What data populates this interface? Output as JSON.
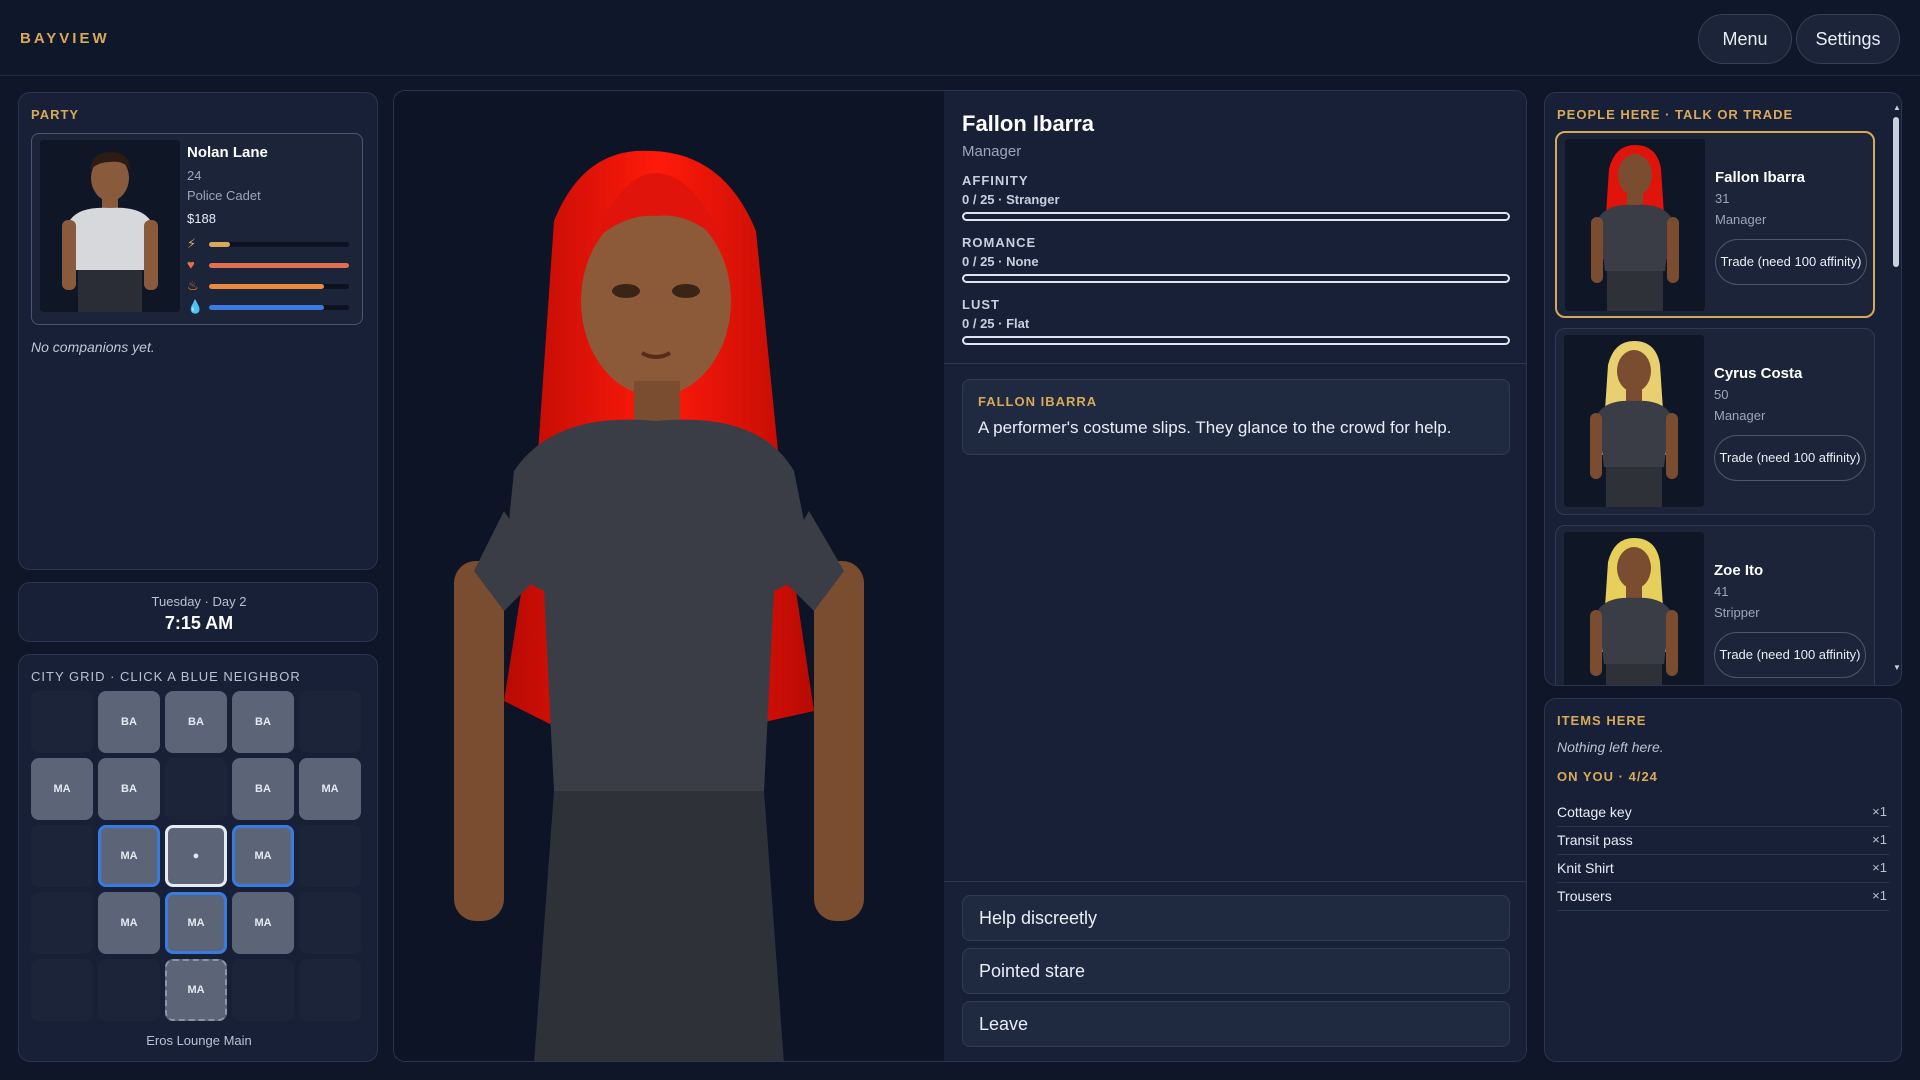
{
  "app": {
    "brand": "BAYVIEW"
  },
  "topbar": {
    "menu_label": "Menu",
    "settings_label": "Settings"
  },
  "party": {
    "label": "PARTY",
    "member": {
      "name": "Nolan Lane",
      "age": "24",
      "role": "Police Cadet",
      "cash": "$188",
      "stats": [
        {
          "icon": "energy-icon",
          "glyph": "⚡",
          "color": "#d9a95a",
          "value": 0.15
        },
        {
          "icon": "heart-icon",
          "glyph": "♥",
          "color": "#e07050",
          "value": 1.0
        },
        {
          "icon": "food-icon",
          "glyph": "♨",
          "color": "#e88a40",
          "value": 0.82
        },
        {
          "icon": "water-icon",
          "glyph": "💧",
          "color": "#3a7be0",
          "value": 0.82
        }
      ]
    },
    "companions_text": "No companions yet."
  },
  "clock": {
    "day": "Tuesday · Day 2",
    "time": "7:15 AM"
  },
  "city_grid": {
    "label": "CITY GRID · CLICK A BLUE NEIGHBOR",
    "location": "Eros Lounge Main",
    "rows": [
      [
        "",
        "BA",
        "BA",
        "BA",
        ""
      ],
      [
        "MA",
        "BA",
        "",
        "BA",
        "MA"
      ],
      [
        "",
        "MA",
        "●",
        "MA",
        ""
      ],
      [
        "",
        "MA",
        "MA",
        "MA",
        ""
      ],
      [
        "",
        "",
        "MA",
        "",
        ""
      ]
    ]
  },
  "character": {
    "name": "Fallon Ibarra",
    "role": "Manager",
    "meters": [
      {
        "label": "AFFINITY",
        "value": "0 / 25 · Stranger",
        "fraction": 0
      },
      {
        "label": "ROMANCE",
        "value": "0 / 25 · None",
        "fraction": 0
      },
      {
        "label": "LUST",
        "value": "0 / 25 · Flat",
        "fraction": 0
      }
    ],
    "event": {
      "speaker": "FALLON IBARRA",
      "text": "A performer's costume slips. They glance to the crowd for help."
    },
    "choices": [
      "Help discreetly",
      "Pointed stare",
      "Leave"
    ]
  },
  "people": {
    "label": "PEOPLE HERE · TALK OR TRADE",
    "list": [
      {
        "name": "Fallon Ibarra",
        "age": "31",
        "role": "Manager",
        "trade": "Trade (need 100 affinity)",
        "hair": "#e0140a"
      },
      {
        "name": "Cyrus Costa",
        "age": "50",
        "role": "Manager",
        "trade": "Trade (need 100 affinity)",
        "hair": "#e8d070"
      },
      {
        "name": "Zoe Ito",
        "age": "41",
        "role": "Stripper",
        "trade": "Trade (need 100 affinity)",
        "hair": "#e6cf5a"
      }
    ]
  },
  "items": {
    "label": "ITEMS HERE",
    "empty_text": "Nothing left here.",
    "on_you_label": "ON YOU · 4/24",
    "inventory": [
      {
        "name": "Cottage key",
        "qty": "×1"
      },
      {
        "name": "Transit pass",
        "qty": "×1"
      },
      {
        "name": "Knit Shirt",
        "qty": "×1"
      },
      {
        "name": "Trousers",
        "qty": "×1"
      }
    ]
  }
}
